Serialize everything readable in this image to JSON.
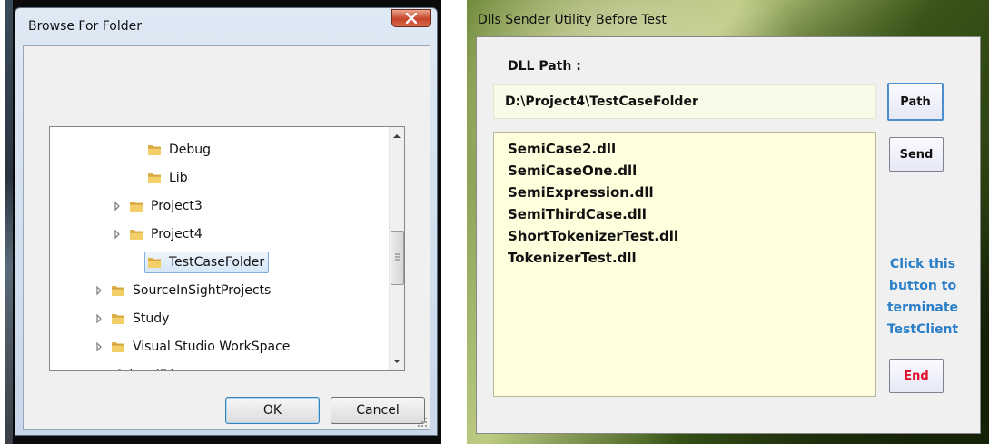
{
  "browse_dialog": {
    "title": "Browse For Folder",
    "close_glyph": "x",
    "tree": [
      {
        "label": "Debug",
        "icon": "folder-icon",
        "has_children": false,
        "indent": 2,
        "selected": false
      },
      {
        "label": "Lib",
        "icon": "folder-icon",
        "has_children": false,
        "indent": 2,
        "selected": false
      },
      {
        "label": "Project3",
        "icon": "folder-icon",
        "has_children": true,
        "indent": 1,
        "selected": false
      },
      {
        "label": "Project4",
        "icon": "folder-icon",
        "has_children": true,
        "indent": 1,
        "selected": false
      },
      {
        "label": "TestCaseFolder",
        "icon": "folder-icon",
        "has_children": false,
        "indent": 2,
        "selected": true
      },
      {
        "label": "SourceInSightProjects",
        "icon": "folder-icon",
        "has_children": true,
        "indent": 0,
        "selected": false
      },
      {
        "label": "Study",
        "icon": "folder-icon",
        "has_children": true,
        "indent": 0,
        "selected": false
      },
      {
        "label": "Visual Studio WorkSpace",
        "icon": "folder-icon",
        "has_children": true,
        "indent": 0,
        "selected": false
      },
      {
        "label": "Other (F:)",
        "icon": "drive-icon",
        "has_children": true,
        "indent": -1,
        "selected": false
      }
    ],
    "ok_label": "OK",
    "cancel_label": "Cancel"
  },
  "dll_utility": {
    "title": "Dlls Sender Utility Before Test",
    "dll_path_label": "DLL Path :",
    "dll_path_value": "D:\\Project4\\TestCaseFolder",
    "path_button": "Path",
    "send_button": "Send",
    "end_button": "End",
    "end_hint_lines": [
      "Click this",
      "button to",
      "terminate",
      "TestClient"
    ],
    "dll_files": [
      "SemiCase2.dll",
      "SemiCaseOne.dll",
      "SemiExpression.dll",
      "SemiThirdCase.dll",
      "ShortTokenizerTest.dll",
      "TokenizerTest.dll"
    ],
    "colors": {
      "hint_text": "#2a7fc8",
      "end_text": "#e0102a",
      "list_background": "#ffffdd",
      "path_field_background": "#fafae8"
    }
  }
}
